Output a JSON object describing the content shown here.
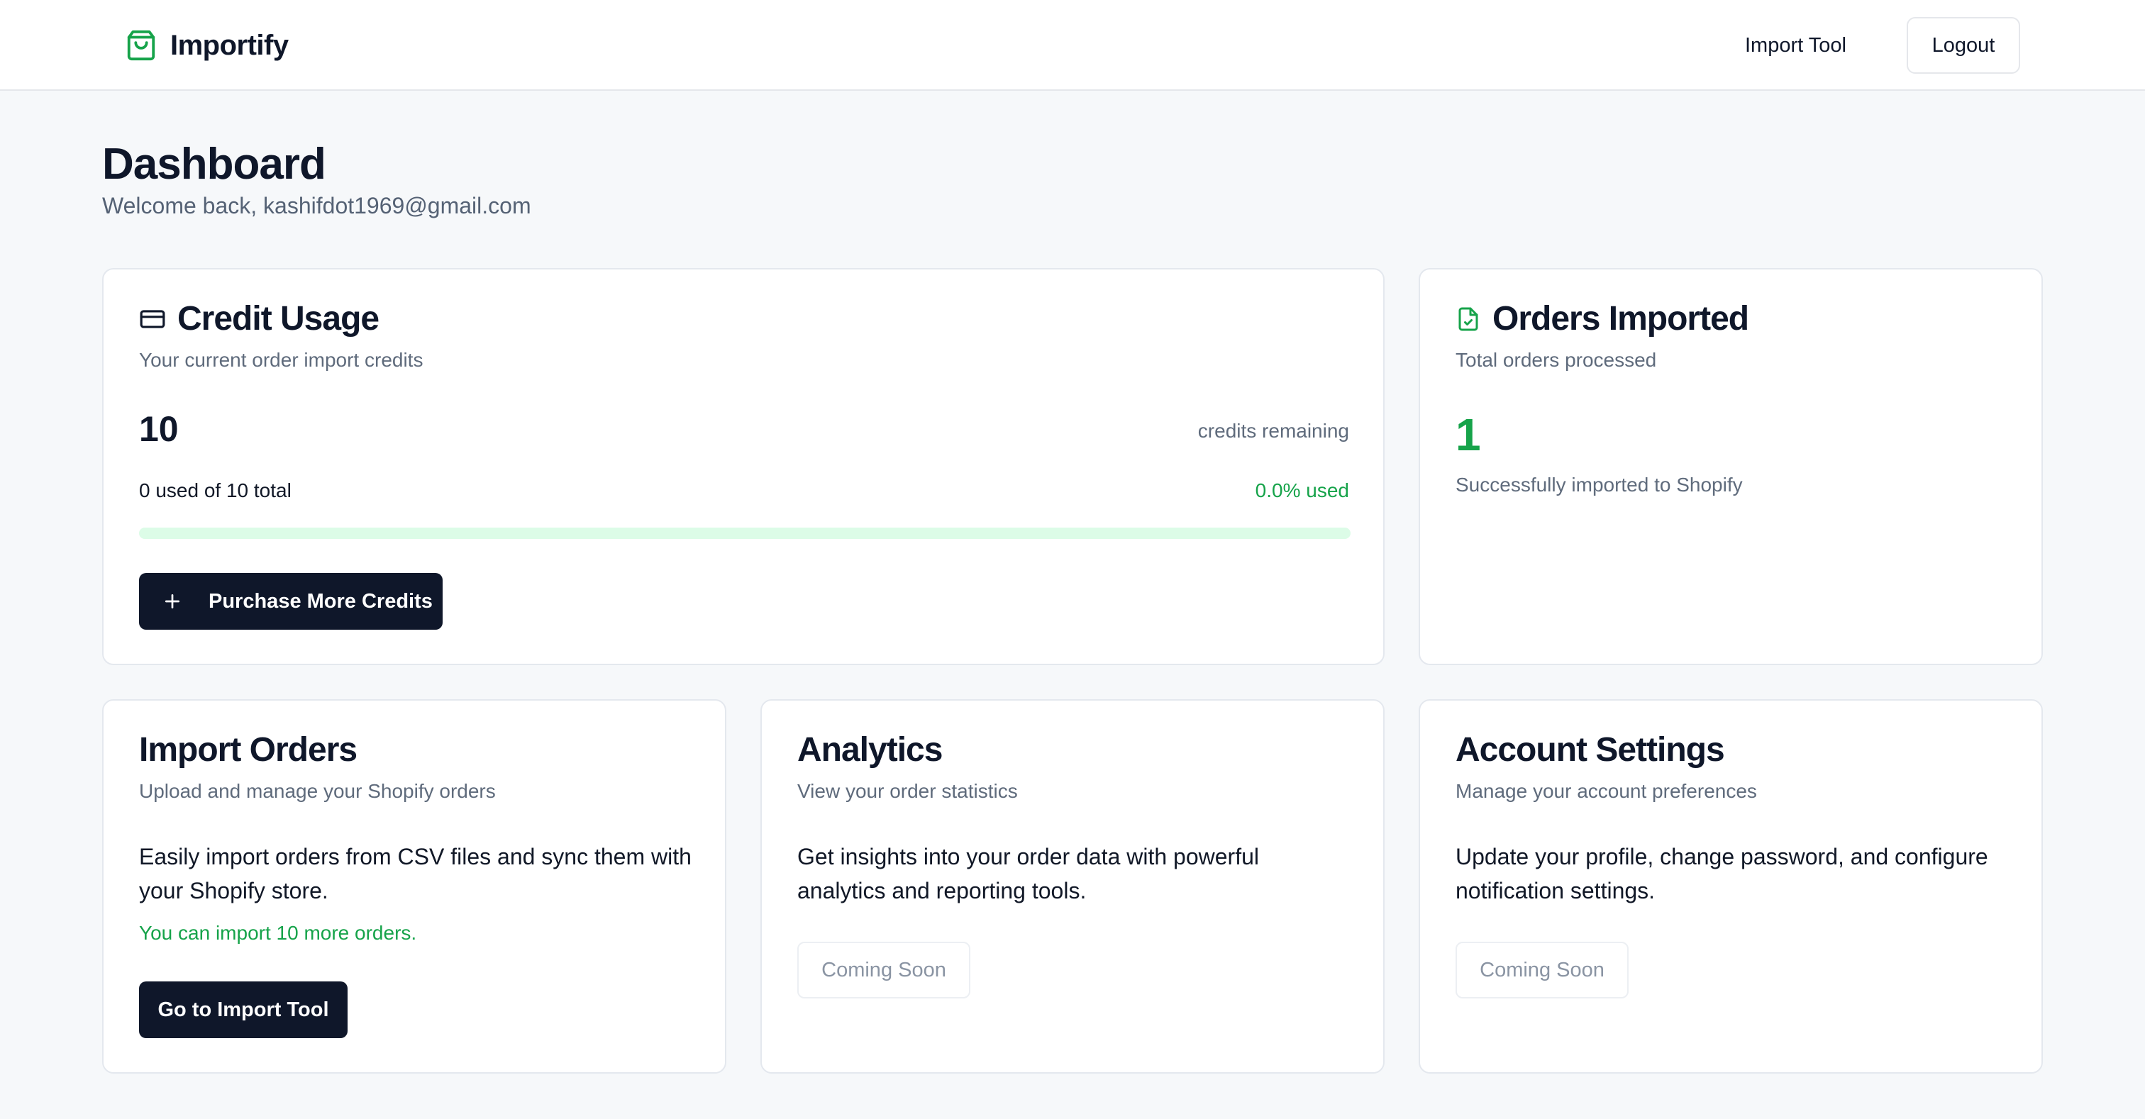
{
  "app": {
    "name": "Importify"
  },
  "nav": {
    "import_tool": "Import Tool",
    "logout": "Logout"
  },
  "header": {
    "title": "Dashboard",
    "subtitle": "Welcome back, kashifdot1969@gmail.com"
  },
  "credit_usage": {
    "title": "Credit Usage",
    "subtitle": "Your current order import credits",
    "remaining_value": "10",
    "remaining_label": "credits remaining",
    "used_text": "0 used of 10 total",
    "percent_text": "0.0% used",
    "progress_fraction": 0.0,
    "button": "Purchase More Credits"
  },
  "orders_imported": {
    "title": "Orders Imported",
    "subtitle": "Total orders processed",
    "count": "1",
    "caption": "Successfully imported to Shopify"
  },
  "import_orders": {
    "title": "Import Orders",
    "subtitle": "Upload and manage your Shopify orders",
    "body": "Easily import orders from CSV files and sync them with your Shopify store.",
    "note": "You can import 10 more orders.",
    "button": "Go to Import Tool"
  },
  "analytics": {
    "title": "Analytics",
    "subtitle": "View your order statistics",
    "body": "Get insights into your order data with powerful analytics and reporting tools.",
    "button": "Coming Soon"
  },
  "account_settings": {
    "title": "Account Settings",
    "subtitle": "Manage your account preferences",
    "body": "Update your profile, change password, and configure notification settings.",
    "button": "Coming Soon"
  },
  "colors": {
    "accent_green": "#16a34a",
    "progress_track": "#dcfce7",
    "dark_button": "#0f172a",
    "page_bg": "#f6f8fa"
  },
  "icons": {
    "brand": "shopping-bag-icon",
    "credit": "credit-card-icon",
    "orders": "file-check-icon",
    "purchase": "plus-icon"
  }
}
